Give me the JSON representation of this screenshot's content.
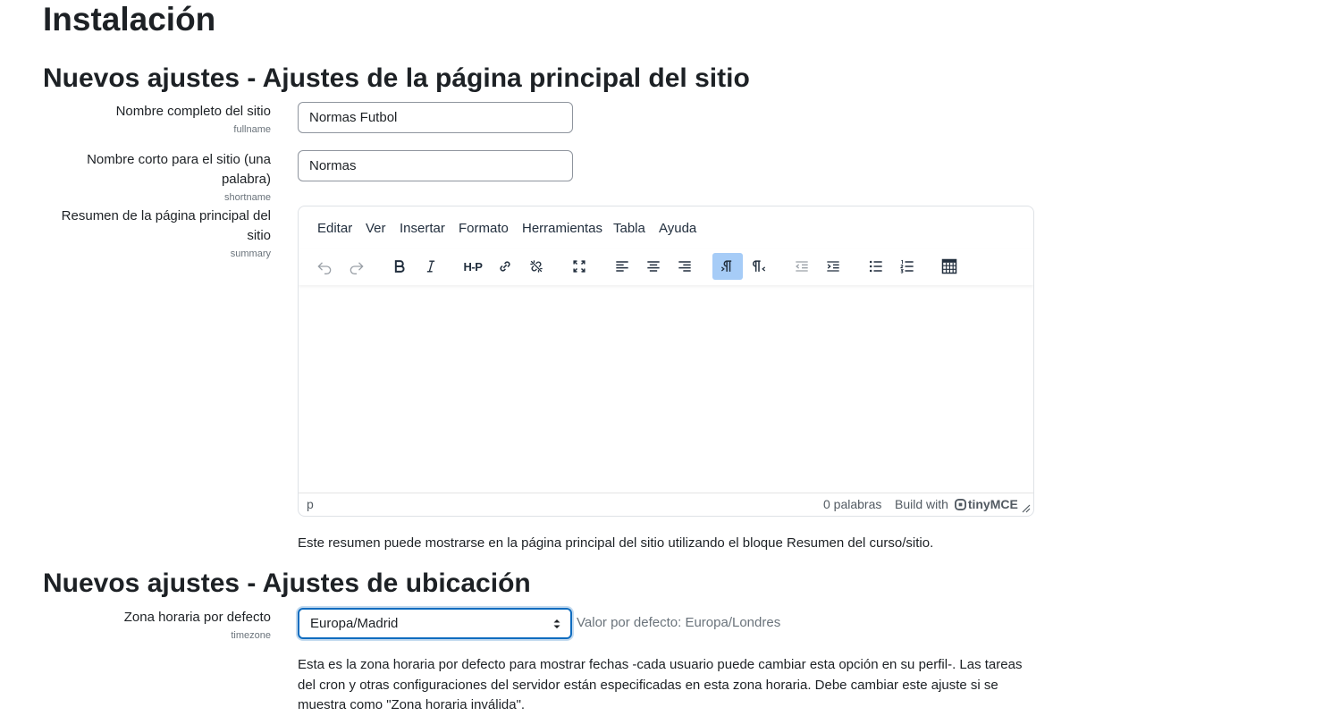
{
  "page": {
    "title": "Instalación"
  },
  "section_frontpage": {
    "title": "Nuevos ajustes - Ajustes de la página principal del sitio",
    "fullname": {
      "label": "Nombre completo del sitio",
      "setting": "fullname",
      "value": "Normas Futbol"
    },
    "shortname": {
      "label_line1": "Nombre corto para el sitio (una",
      "label_line2": "palabra)",
      "setting": "shortname",
      "value": "Normas"
    },
    "summary": {
      "label_line1": "Resumen de la página principal del",
      "label_line2": "sitio",
      "setting": "summary",
      "description": "Este resumen puede mostrarse en la página principal del sitio utilizando el bloque Resumen del curso/sitio."
    }
  },
  "editor": {
    "menu": [
      "Editar",
      "Ver",
      "Insertar",
      "Formato",
      "Herramientas",
      "Tabla",
      "Ayuda"
    ],
    "toolbar": {
      "undo": "undo-icon",
      "redo": "redo-icon",
      "bold": "bold-icon",
      "italic": "italic-icon",
      "h5p": "H-P",
      "link": "link-icon",
      "unlink": "unlink-icon",
      "fullscreen": "fullscreen-icon",
      "align_left": "align-left-icon",
      "align_center": "align-center-icon",
      "align_right": "align-right-icon",
      "ltr": "ltr-icon",
      "rtl": "rtl-icon",
      "outdent": "outdent-icon",
      "indent": "indent-icon",
      "bullist": "bullet-list-icon",
      "numlist": "numbered-list-icon",
      "table": "table-icon"
    },
    "status": {
      "path": "p",
      "words": "0 palabras",
      "build_prefix": "Build with",
      "brand": "tinyMCE"
    }
  },
  "section_location": {
    "title": "Nuevos ajustes - Ajustes de ubicación",
    "timezone": {
      "label": "Zona horaria por defecto",
      "setting": "timezone",
      "value": "Europa/Madrid",
      "default_text": "Valor por defecto: Europa/Londres",
      "description_line1": "Esta es la zona horaria por defecto para mostrar fechas -cada usuario puede cambiar esta opción en su perfil-. Las tareas",
      "description_line2": "del cron y otras configuraciones del servidor están especificadas en esta zona horaria. Debe cambiar este ajuste si se",
      "description_line3": "muestra como \"Zona horaria inválida\"."
    }
  },
  "colors": {
    "focus": "#0f6cbf",
    "active_button": "#a6ccf7",
    "muted": "#6a737b"
  }
}
